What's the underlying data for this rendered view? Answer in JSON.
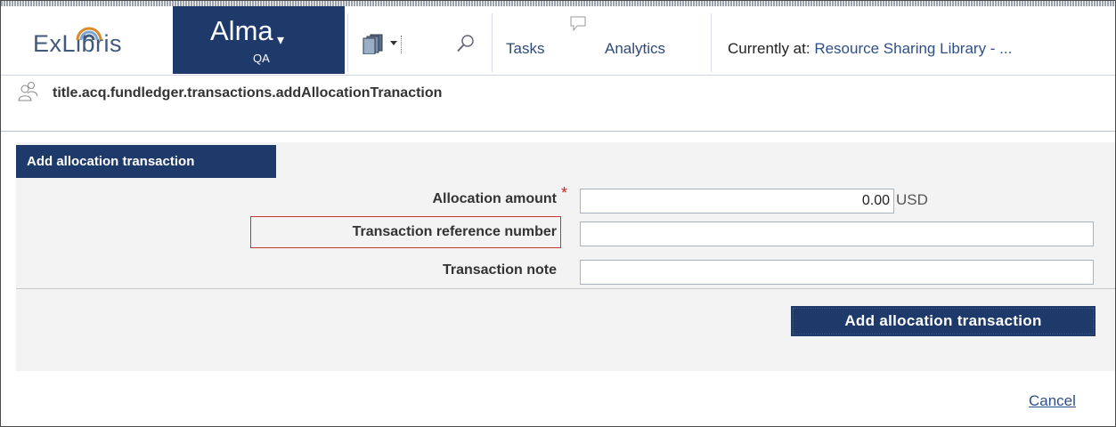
{
  "header": {
    "logo_text": "ExLibris",
    "product": "Alma",
    "product_chevron": "▾",
    "environment": "QA",
    "search": {
      "placeholder": "",
      "value": ""
    },
    "nav": {
      "tasks": "Tasks",
      "analytics": "Analytics"
    },
    "location": {
      "label": "Currently at: ",
      "value": "Resource Sharing Library - ..."
    },
    "icons": [
      "books-icon",
      "dropdown-arrow-icon",
      "magnifier-icon",
      "speech-bubble-icon"
    ]
  },
  "page": {
    "title": "title.acq.fundledger.transactions.addAllocationTranaction",
    "icon": "users-icon"
  },
  "form": {
    "tab_label": "Add allocation transaction",
    "fields": [
      {
        "label": "Allocation amount",
        "required": true,
        "value": "0.00",
        "suffix": "USD"
      },
      {
        "label": "Transaction reference number",
        "value": ""
      },
      {
        "label": "Transaction note",
        "value": ""
      }
    ],
    "submit_label": "Add allocation transaction",
    "cancel_label": "Cancel"
  },
  "colors": {
    "brand_navy": "#1d3a6b",
    "link": "#2f4f88",
    "highlight": "#c0392b",
    "required": "#c62828"
  }
}
